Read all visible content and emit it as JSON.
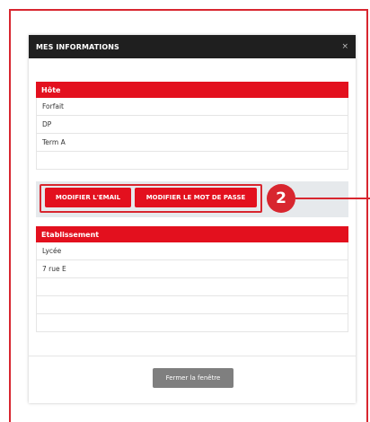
{
  "modal": {
    "title": "MES INFORMATIONS",
    "close_icon": "×"
  },
  "host_section": {
    "header": "Hôte",
    "rows": [
      "Forfait",
      "DP",
      "Term A",
      ""
    ]
  },
  "buttons": {
    "modify_email": "MODIFIER L'EMAIL",
    "modify_password": "MODIFIER LE MOT DE PASSE"
  },
  "callout": {
    "number": "2"
  },
  "school_section": {
    "header": "Etablissement",
    "rows": [
      "Lycée",
      "7 rue E",
      "",
      "",
      "",
      ""
    ]
  },
  "footer": {
    "close_window": "Fermer la fenêtre"
  },
  "colors": {
    "accent_red": "#e3101e",
    "header_dark": "#1f1f1f",
    "annotation_red": "#d8262f"
  }
}
